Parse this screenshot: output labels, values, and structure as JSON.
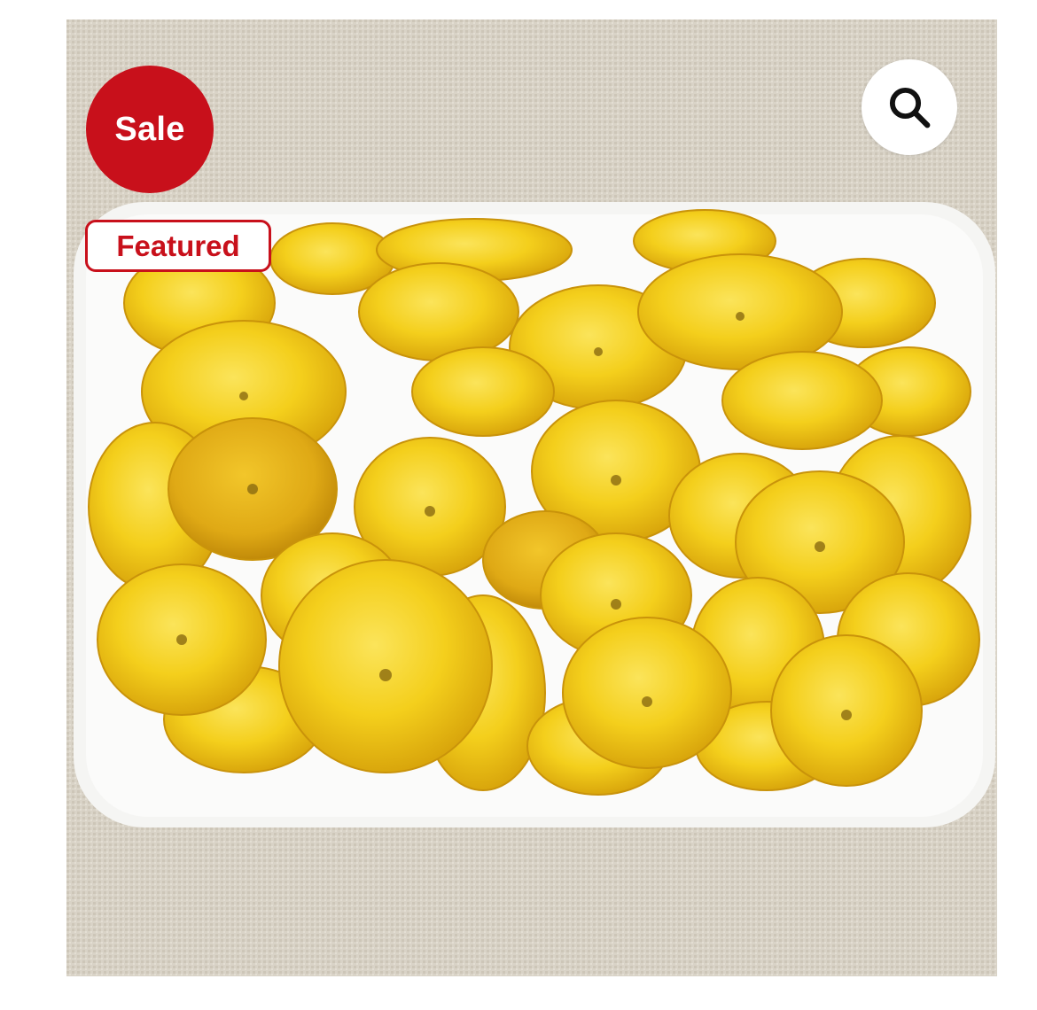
{
  "badges": {
    "sale_label": "Sale",
    "featured_label": "Featured"
  },
  "zoom": {
    "icon": "search-icon"
  },
  "colors": {
    "sale_badge_bg": "#c8101b",
    "featured_text": "#c8101b",
    "featured_border": "#c8101b",
    "icon_color": "#111111"
  }
}
